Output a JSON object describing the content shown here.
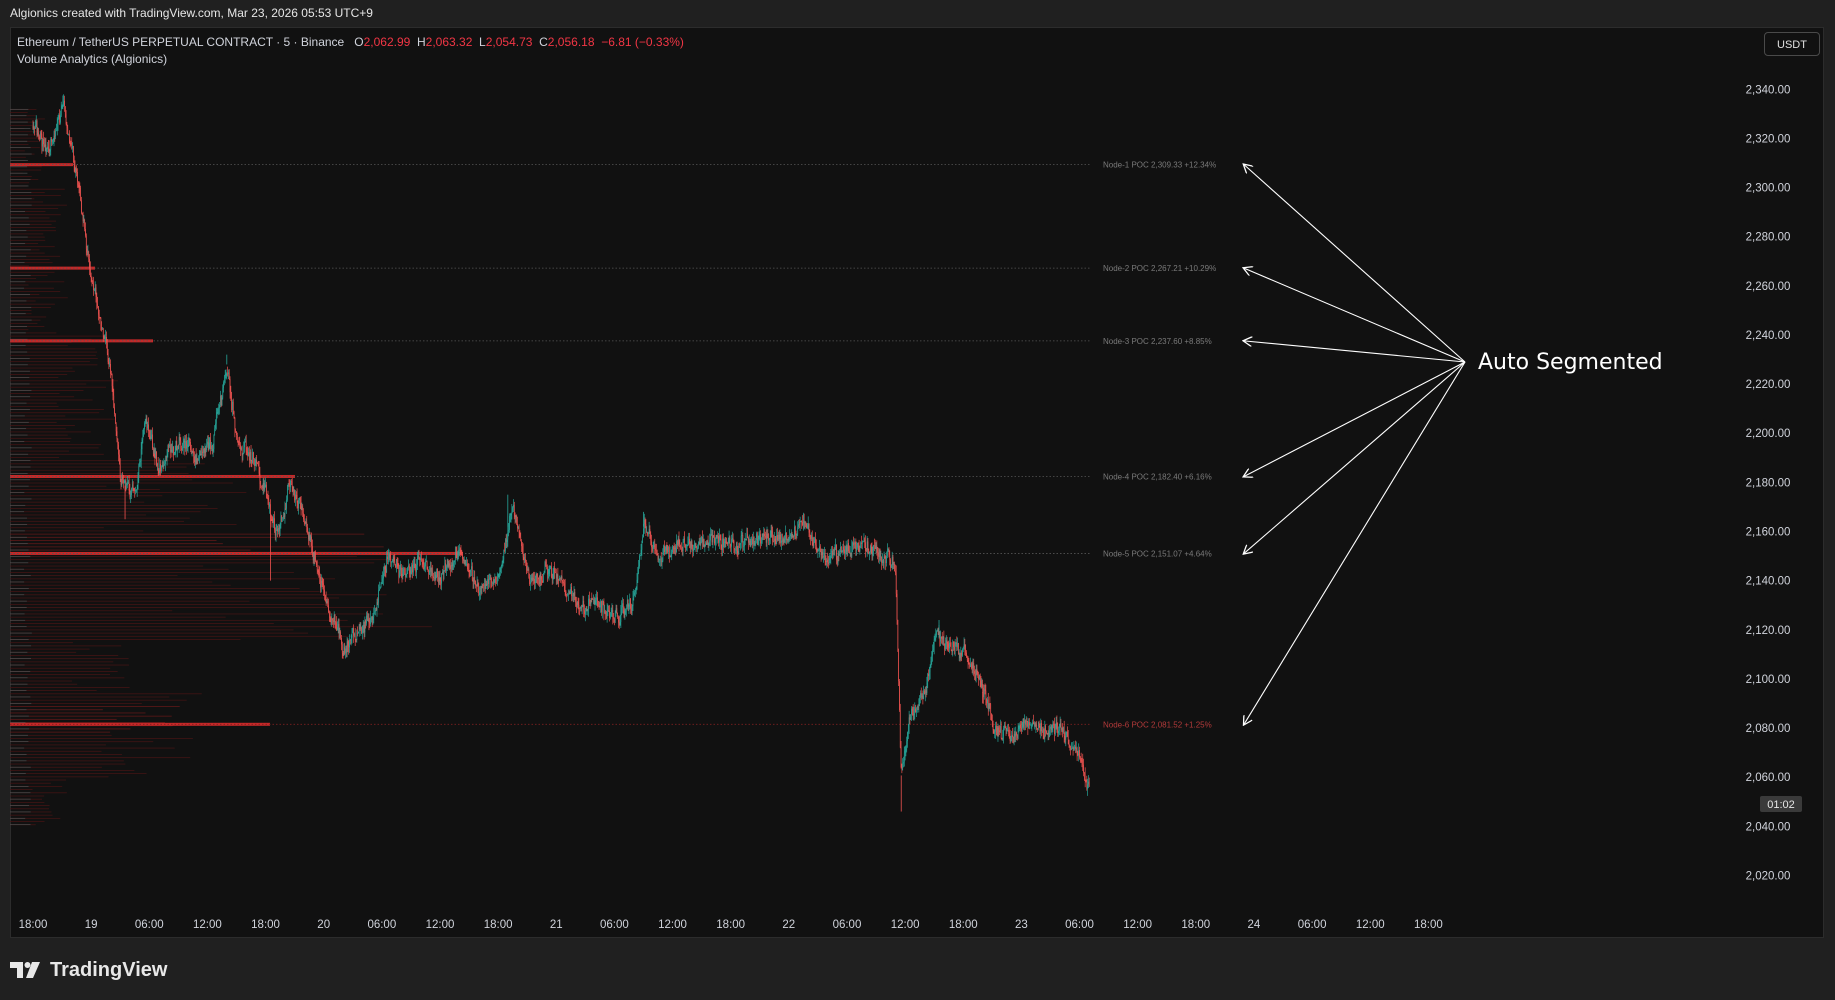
{
  "window": {
    "title": "Algionics created with TradingView.com, Mar 23, 2026 05:53 UTC+9"
  },
  "legend": {
    "symbol": "Ethereum / TetherUS PERPETUAL CONTRACT · 5 · Binance",
    "o_label": "O",
    "o_value": "2,062.99",
    "h_label": "H",
    "h_value": "2,063.32",
    "l_label": "L",
    "l_value": "2,054.73",
    "c_label": "C",
    "c_value": "2,056.18",
    "change": "−6.81 (−0.33%)",
    "indicator": "Volume Analytics (Algionics)"
  },
  "currency_button": "USDT",
  "countdown": "01:02",
  "annotation_text": "Auto Segmented",
  "footer": {
    "brand": "TradingView"
  },
  "colors": {
    "up": "#26a69a",
    "down": "#ef5350",
    "poc": "#c62828",
    "background": "#111111"
  },
  "chart_data": {
    "type": "candlestick",
    "ylim": [
      2010,
      2356
    ],
    "y_ticks": [
      "2,340.00",
      "2,320.00",
      "2,300.00",
      "2,280.00",
      "2,260.00",
      "2,240.00",
      "2,220.00",
      "2,200.00",
      "2,180.00",
      "2,160.00",
      "2,140.00",
      "2,120.00",
      "2,100.00",
      "2,080.00",
      "2,060.00",
      "2,040.00",
      "2,020.00"
    ],
    "y_tick_values": [
      2340,
      2320,
      2300,
      2280,
      2260,
      2240,
      2220,
      2200,
      2180,
      2160,
      2140,
      2120,
      2100,
      2080,
      2060,
      2040,
      2020
    ],
    "x_ticks": [
      "18:00",
      "19",
      "06:00",
      "12:00",
      "18:00",
      "20",
      "06:00",
      "12:00",
      "18:00",
      "21",
      "06:00",
      "12:00",
      "18:00",
      "22",
      "06:00",
      "12:00",
      "18:00",
      "23",
      "06:00",
      "12:00",
      "18:00",
      "24",
      "06:00",
      "12:00",
      "18:00"
    ],
    "x_tick_hours": [
      0,
      6,
      12,
      18,
      24,
      30,
      36,
      42,
      48,
      54,
      60,
      66,
      72,
      78,
      84,
      90,
      96,
      102,
      108,
      114,
      120,
      126,
      132,
      138,
      144
    ],
    "last_hour": 109,
    "last_price": 2056.18,
    "price_path": [
      {
        "h": 0,
        "p": 2325
      },
      {
        "h": 1.5,
        "p": 2313
      },
      {
        "h": 3,
        "p": 2333
      },
      {
        "h": 4.2,
        "p": 2312
      },
      {
        "h": 5,
        "p": 2292
      },
      {
        "h": 6,
        "p": 2262
      },
      {
        "h": 7,
        "p": 2245
      },
      {
        "h": 8,
        "p": 2222
      },
      {
        "h": 9,
        "p": 2180
      },
      {
        "h": 10.5,
        "p": 2176
      },
      {
        "h": 11.5,
        "p": 2205
      },
      {
        "h": 13,
        "p": 2185
      },
      {
        "h": 14,
        "p": 2193
      },
      {
        "h": 15.5,
        "p": 2198
      },
      {
        "h": 17,
        "p": 2189
      },
      {
        "h": 18.5,
        "p": 2196
      },
      {
        "h": 20,
        "p": 2228
      },
      {
        "h": 21,
        "p": 2196
      },
      {
        "h": 23,
        "p": 2188
      },
      {
        "h": 25,
        "p": 2160
      },
      {
        "h": 26.5,
        "p": 2178
      },
      {
        "h": 28,
        "p": 2165
      },
      {
        "h": 30,
        "p": 2135
      },
      {
        "h": 32,
        "p": 2112
      },
      {
        "h": 33.5,
        "p": 2119
      },
      {
        "h": 35,
        "p": 2125
      },
      {
        "h": 36.5,
        "p": 2150
      },
      {
        "h": 38,
        "p": 2142
      },
      {
        "h": 40,
        "p": 2147
      },
      {
        "h": 42,
        "p": 2140
      },
      {
        "h": 44,
        "p": 2152
      },
      {
        "h": 46,
        "p": 2135
      },
      {
        "h": 48,
        "p": 2142
      },
      {
        "h": 49.5,
        "p": 2172
      },
      {
        "h": 51,
        "p": 2140
      },
      {
        "h": 53,
        "p": 2145
      },
      {
        "h": 55,
        "p": 2138
      },
      {
        "h": 56.5,
        "p": 2128
      },
      {
        "h": 58,
        "p": 2132
      },
      {
        "h": 60,
        "p": 2124
      },
      {
        "h": 62,
        "p": 2132
      },
      {
        "h": 63,
        "p": 2162
      },
      {
        "h": 64.5,
        "p": 2148
      },
      {
        "h": 66,
        "p": 2154
      },
      {
        "h": 68,
        "p": 2155
      },
      {
        "h": 70,
        "p": 2157
      },
      {
        "h": 72,
        "p": 2154
      },
      {
        "h": 74,
        "p": 2157
      },
      {
        "h": 76,
        "p": 2158
      },
      {
        "h": 78,
        "p": 2158
      },
      {
        "h": 79.5,
        "p": 2165
      },
      {
        "h": 81,
        "p": 2152
      },
      {
        "h": 83,
        "p": 2150
      },
      {
        "h": 85,
        "p": 2154
      },
      {
        "h": 87,
        "p": 2153
      },
      {
        "h": 89,
        "p": 2145
      },
      {
        "h": 89.5,
        "p": 2058
      },
      {
        "h": 90.5,
        "p": 2085
      },
      {
        "h": 92,
        "p": 2095
      },
      {
        "h": 93,
        "p": 2118
      },
      {
        "h": 94.5,
        "p": 2115
      },
      {
        "h": 96,
        "p": 2110
      },
      {
        "h": 97.5,
        "p": 2101
      },
      {
        "h": 99,
        "p": 2082
      },
      {
        "h": 101,
        "p": 2075
      },
      {
        "h": 102.5,
        "p": 2083
      },
      {
        "h": 104,
        "p": 2080
      },
      {
        "h": 106,
        "p": 2080
      },
      {
        "h": 107.5,
        "p": 2072
      },
      {
        "h": 108.5,
        "p": 2060
      },
      {
        "h": 109,
        "p": 2056
      }
    ],
    "nodes": [
      {
        "label": "Node-1 POC 2,309.33  +12.34%",
        "price": 2309.33,
        "profile_len": 63,
        "color": "#c62828"
      },
      {
        "label": "Node-2 POC 2,267.21  +10.29%",
        "price": 2267.21,
        "profile_len": 85,
        "color": "#c62828"
      },
      {
        "label": "Node-3 POC 2,237.60  +8.85%",
        "price": 2237.6,
        "profile_len": 143,
        "color": "#c62828"
      },
      {
        "label": "Node-4 POC 2,182.40  +6.16%",
        "price": 2182.4,
        "profile_len": 285,
        "color": "#c62828"
      },
      {
        "label": "Node-5 POC 2,151.07  +4.64%",
        "price": 2151.07,
        "profile_len": 453,
        "color": "#c62828"
      },
      {
        "label": "Node-6 POC 2,081.52  +1.25%",
        "price": 2081.52,
        "profile_len": 260,
        "color": "#c62828"
      }
    ]
  }
}
